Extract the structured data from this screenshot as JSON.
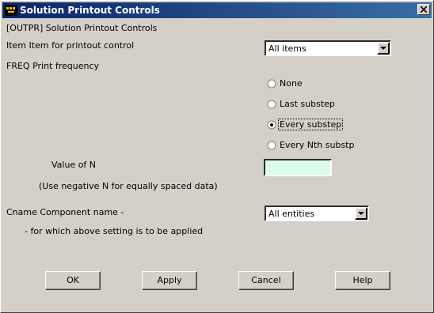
{
  "window": {
    "title": "Solution Printout Controls",
    "icon": "ansys-app-icon"
  },
  "header": {
    "command_label": "[OUTPR]  Solution Printout Controls"
  },
  "item": {
    "label": "Item   Item for printout control",
    "selected": "All items"
  },
  "freq": {
    "label": "FREQ   Print frequency",
    "options": [
      {
        "label": "None",
        "selected": false
      },
      {
        "label": "Last substep",
        "selected": false
      },
      {
        "label": "Every substep",
        "selected": true
      },
      {
        "label": "Every Nth substp",
        "selected": false
      }
    ]
  },
  "n_value": {
    "label": "Value of N",
    "hint": "(Use negative N for equally spaced data)",
    "value": ""
  },
  "cname": {
    "label": "Cname  Component name -",
    "sub_label": "- for which above setting is to be applied",
    "selected": "All entities"
  },
  "buttons": {
    "ok": "OK",
    "apply": "Apply",
    "cancel": "Cancel",
    "help": "Help"
  },
  "colors": {
    "title_bar_start": "#0a246a",
    "title_bar_end": "#3a6ea5",
    "input_bg": "#ddfce8",
    "dialog_bg": "#d4d0c8"
  }
}
